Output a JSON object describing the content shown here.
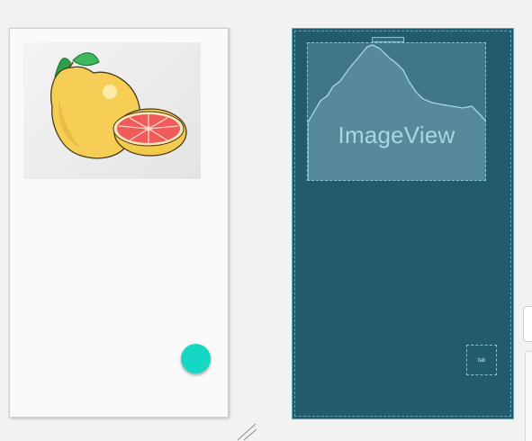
{
  "design_preview": {
    "image_description_icon": "grapefruit-image",
    "fab_color": "#14d8c4"
  },
  "blueprint": {
    "image_view_label": "ImageView",
    "fab_label": "fab",
    "background_color": "#235b6e",
    "outline_color": "#8cc3d3"
  },
  "colors": {
    "canvas_background": "#f2f2f2",
    "design_surface": "#fafafa",
    "accent": "#14d8c4"
  }
}
